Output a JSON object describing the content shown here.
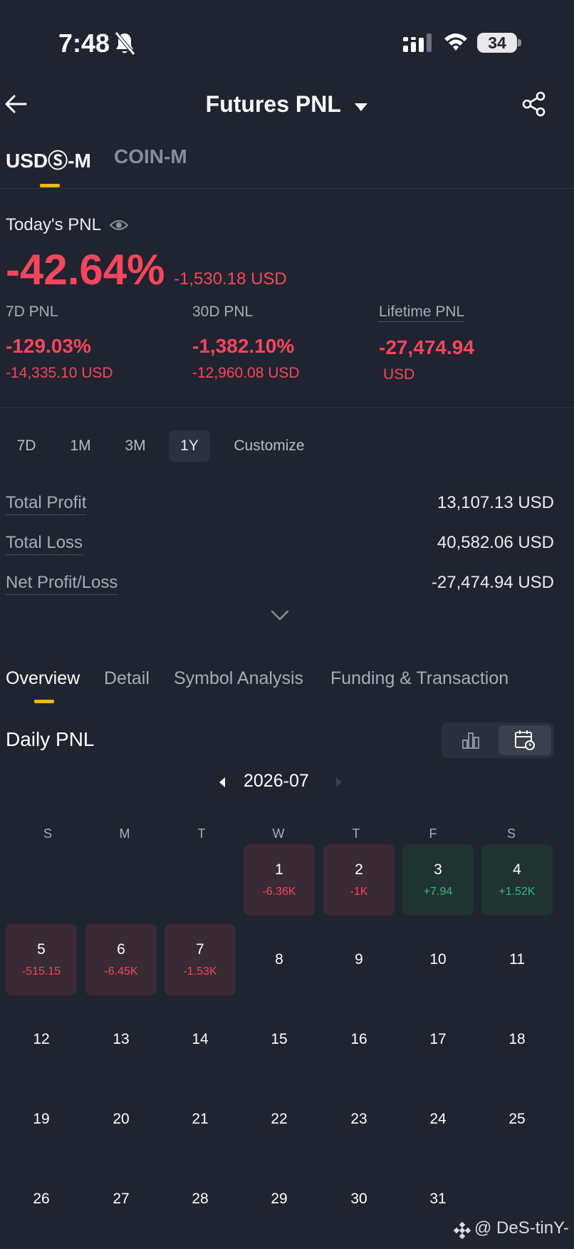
{
  "status_bar": {
    "time": "7:48",
    "battery": "34"
  },
  "header": {
    "title": "Futures PNL"
  },
  "account_tabs": [
    {
      "label": "USDⓈ-M",
      "active": true
    },
    {
      "label": "COIN-M",
      "active": false
    }
  ],
  "today": {
    "label": "Today's PNL",
    "percent": "-42.64%",
    "usd": "-1,530.18 USD"
  },
  "stats": [
    {
      "label": "7D PNL",
      "percent": "-129.03%",
      "usd": "-14,335.10 USD"
    },
    {
      "label": "30D PNL",
      "percent": "-1,382.10%",
      "usd": "-12,960.08 USD"
    },
    {
      "label": "Lifetime PNL",
      "percent": "-27,474.94",
      "usd": "USD"
    }
  ],
  "periods": [
    {
      "label": "7D",
      "active": false
    },
    {
      "label": "1M",
      "active": false
    },
    {
      "label": "3M",
      "active": false
    },
    {
      "label": "1Y",
      "active": true
    },
    {
      "label": "Customize",
      "active": false
    }
  ],
  "summary": [
    {
      "label": "Total Profit",
      "value": "13,107.13 USD"
    },
    {
      "label": "Total Loss",
      "value": "40,582.06 USD"
    },
    {
      "label": "Net Profit/Loss",
      "value": "-27,474.94 USD"
    }
  ],
  "section_tabs": [
    {
      "label": "Overview",
      "active": true
    },
    {
      "label": "Detail",
      "active": false
    },
    {
      "label": "Symbol Analysis",
      "active": false
    },
    {
      "label": "Funding & Transaction",
      "active": false
    }
  ],
  "daily": {
    "title": "Daily PNL",
    "month": "2026-07",
    "weekdays": [
      "S",
      "M",
      "T",
      "W",
      "T",
      "F",
      "S"
    ],
    "first_weekday_index": 3,
    "days": [
      {
        "day": "1",
        "pnl": "-6.36K",
        "type": "loss"
      },
      {
        "day": "2",
        "pnl": "-1K",
        "type": "loss"
      },
      {
        "day": "3",
        "pnl": "+7.94",
        "type": "gain"
      },
      {
        "day": "4",
        "pnl": "+1.52K",
        "type": "gain"
      },
      {
        "day": "5",
        "pnl": "-515.15",
        "type": "loss"
      },
      {
        "day": "6",
        "pnl": "-6.45K",
        "type": "loss"
      },
      {
        "day": "7",
        "pnl": "-1.53K",
        "type": "loss"
      },
      {
        "day": "8"
      },
      {
        "day": "9"
      },
      {
        "day": "10"
      },
      {
        "day": "11"
      },
      {
        "day": "12"
      },
      {
        "day": "13"
      },
      {
        "day": "14"
      },
      {
        "day": "15"
      },
      {
        "day": "16"
      },
      {
        "day": "17"
      },
      {
        "day": "18"
      },
      {
        "day": "19"
      },
      {
        "day": "20"
      },
      {
        "day": "21"
      },
      {
        "day": "22"
      },
      {
        "day": "23"
      },
      {
        "day": "24"
      },
      {
        "day": "25"
      },
      {
        "day": "26"
      },
      {
        "day": "27"
      },
      {
        "day": "28"
      },
      {
        "day": "29"
      },
      {
        "day": "30"
      },
      {
        "day": "31"
      }
    ]
  },
  "watermark": "@ DeS-tinY-",
  "colors": {
    "background": "#1f2430",
    "loss": "#f6465d",
    "gain": "#2ebd85",
    "accent": "#f0b90b"
  }
}
